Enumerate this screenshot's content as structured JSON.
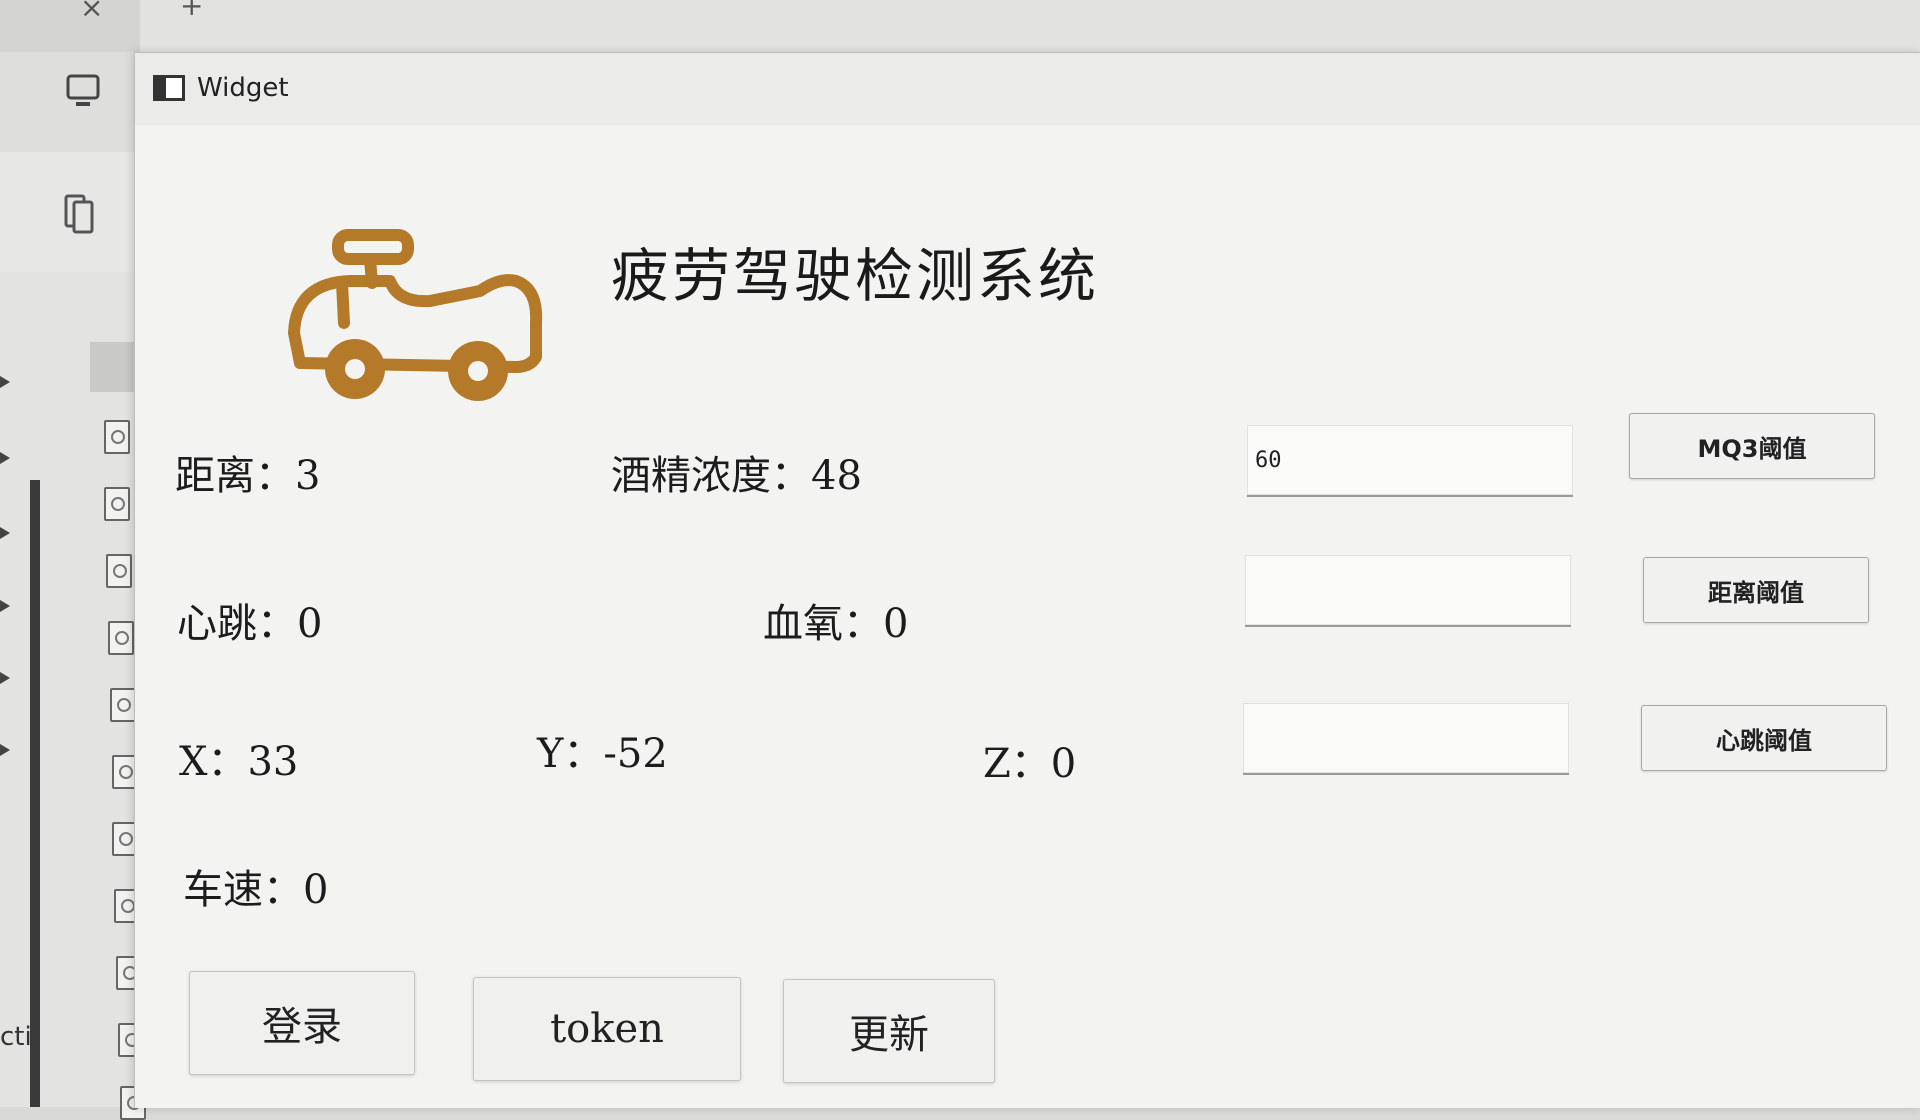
{
  "window": {
    "title": "Widget"
  },
  "app": {
    "title": "疲劳驾驶检测系统"
  },
  "readings": {
    "distance": "距离：3",
    "alcohol": "酒精浓度：48",
    "heartbeat": "心跳：0",
    "blood_oxygen": "血氧：0",
    "x": "X：33",
    "y": "Y：-52",
    "z": "Z：0",
    "speed": "车速：0"
  },
  "thresholds": {
    "mq3": {
      "value": "60",
      "button": "MQ3阈值"
    },
    "distance": {
      "value": "",
      "button": "距离阈值"
    },
    "heartbeat": {
      "value": "",
      "button": "心跳阈值"
    }
  },
  "actions": {
    "login": "登录",
    "token": "token",
    "update": "更新"
  },
  "background": {
    "edge_text": "cti"
  },
  "colors": {
    "logo": "#b5792a",
    "window_bg": "#f3f3f1"
  }
}
